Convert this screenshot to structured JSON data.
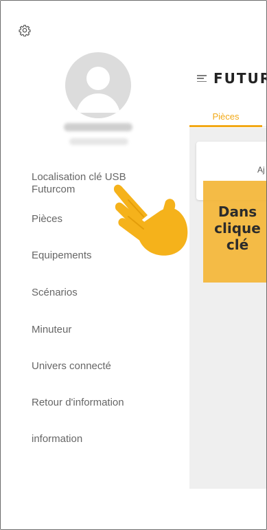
{
  "header": {
    "brand": "FUTUR"
  },
  "tabs": [
    {
      "label": "Pièces",
      "active": true
    }
  ],
  "content": {
    "card_text": "Aj"
  },
  "tooltip": {
    "text": "Dans\nclique\nclé"
  },
  "drawer": {
    "items": [
      {
        "label": "Localisation clé USB Futurcom"
      },
      {
        "label": "Pièces"
      },
      {
        "label": "Equipements"
      },
      {
        "label": "Scénarios"
      },
      {
        "label": "Minuteur"
      },
      {
        "label": "Univers connecté"
      },
      {
        "label": "Retour d'information"
      },
      {
        "label": "information"
      }
    ]
  },
  "colors": {
    "accent": "#f2a917",
    "tooltip_bg": "#f3b73c",
    "hand": "#f5b21b",
    "drawer_text": "#666666"
  },
  "icons": {
    "settings": "gear-icon",
    "menu": "hamburger-icon",
    "pointer": "pointing-hand-icon",
    "avatar": "user-avatar-icon"
  }
}
